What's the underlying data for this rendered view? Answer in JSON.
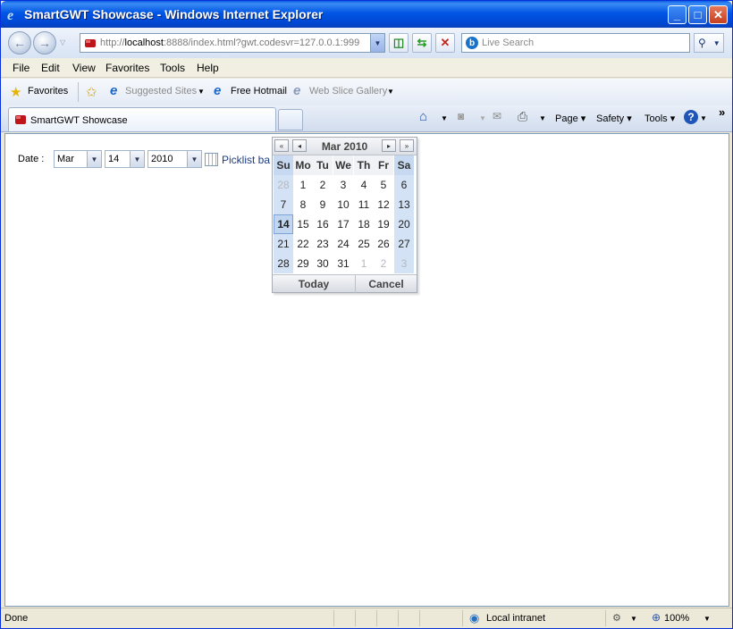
{
  "window": {
    "title": "SmartGWT Showcase - Windows Internet Explorer",
    "minimize": "_",
    "maximize": "□",
    "close": "✕"
  },
  "address": {
    "scheme": "http://",
    "host": "localhost",
    "rest": ":8888/index.html?gwt.codesvr=127.0.0.1:999"
  },
  "search": {
    "placeholder": "Live Search"
  },
  "menu": [
    "File",
    "Edit",
    "View",
    "Favorites",
    "Tools",
    "Help"
  ],
  "favorites": {
    "label": "Favorites",
    "suggested": "Suggested Sites",
    "hotmail": "Free Hotmail",
    "webslice": "Web Slice Gallery"
  },
  "tab": {
    "label": "SmartGWT Showcase"
  },
  "commands": {
    "page": "Page",
    "safety": "Safety",
    "tools": "Tools",
    "more": "»"
  },
  "form": {
    "date_label": "Date :",
    "month": "Mar",
    "day": "14",
    "year": "2010",
    "picklist": "Picklist ba"
  },
  "chooser": {
    "title": "Mar 2010",
    "weekdays": [
      "Su",
      "Mo",
      "Tu",
      "We",
      "Th",
      "Fr",
      "Sa"
    ],
    "weeks": [
      [
        "28",
        "1",
        "2",
        "3",
        "4",
        "5",
        "6"
      ],
      [
        "7",
        "8",
        "9",
        "10",
        "11",
        "12",
        "13"
      ],
      [
        "14",
        "15",
        "16",
        "17",
        "18",
        "19",
        "20"
      ],
      [
        "21",
        "22",
        "23",
        "24",
        "25",
        "26",
        "27"
      ],
      [
        "28",
        "29",
        "30",
        "31",
        "1",
        "2",
        "3"
      ]
    ],
    "today": "Today",
    "cancel": "Cancel"
  },
  "status": {
    "text": "Done",
    "zone": "Local intranet",
    "zoom": "100%"
  }
}
